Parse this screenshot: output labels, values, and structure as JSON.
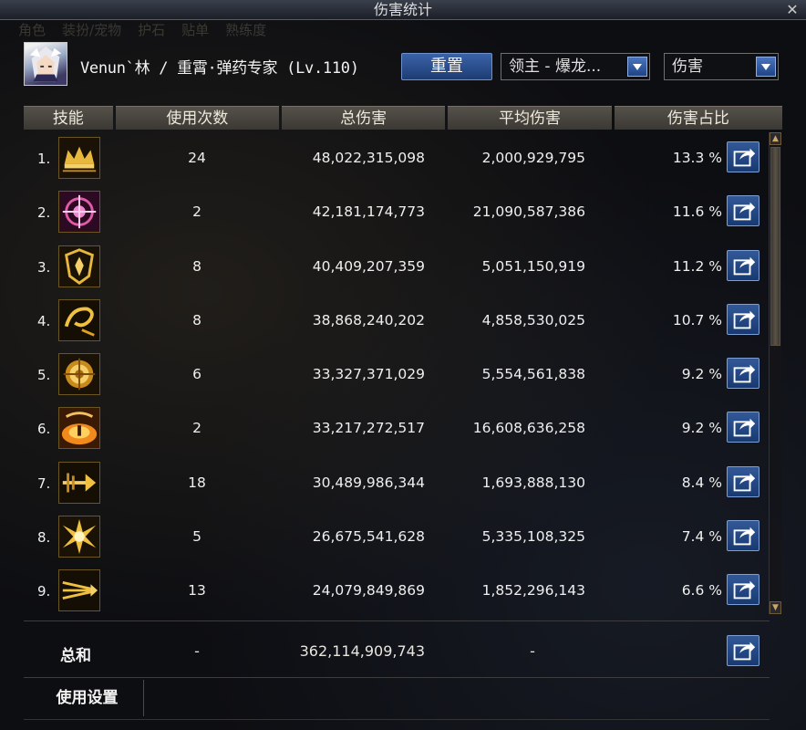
{
  "window": {
    "title": "伤害统计",
    "close_label": "✕"
  },
  "background_tabs": [
    "角色",
    "装扮/宠物",
    "护石",
    "贴单",
    "熟练度"
  ],
  "character": {
    "name_line": "Venun`林 / 重霄·弹药专家 (Lv.110)"
  },
  "controls": {
    "reset_label": "重置",
    "target_select": {
      "value": "领主 - 爆龙..."
    },
    "metric_select": {
      "value": "伤害"
    }
  },
  "table": {
    "headers": {
      "skill": "技能",
      "count": "使用次数",
      "total": "总伤害",
      "avg": "平均伤害",
      "share": "伤害占比"
    },
    "rows": [
      {
        "num": "1.",
        "icon": "golden-crown-skill-icon",
        "count": "24",
        "total": "48,022,315,098",
        "avg": "2,000,929,795",
        "share": "13.3 %"
      },
      {
        "num": "2.",
        "icon": "pink-crosshair-skill-icon",
        "count": "2",
        "total": "42,181,174,773",
        "avg": "21,090,587,386",
        "share": "11.6 %"
      },
      {
        "num": "3.",
        "icon": "golden-shield-skill-icon",
        "count": "8",
        "total": "40,409,207,359",
        "avg": "5,051,150,919",
        "share": "11.2 %"
      },
      {
        "num": "4.",
        "icon": "golden-swirl-skill-icon",
        "count": "8",
        "total": "38,868,240,202",
        "avg": "4,858,530,025",
        "share": "10.7 %"
      },
      {
        "num": "5.",
        "icon": "golden-target-skill-icon",
        "count": "6",
        "total": "33,327,371,029",
        "avg": "5,554,561,838",
        "share": "9.2 %"
      },
      {
        "num": "6.",
        "icon": "orange-blast-skill-icon",
        "count": "2",
        "total": "33,217,272,517",
        "avg": "16,608,636,258",
        "share": "9.2 %"
      },
      {
        "num": "7.",
        "icon": "golden-arrow-skill-icon",
        "count": "18",
        "total": "30,489,986,344",
        "avg": "1,693,888,130",
        "share": "8.4 %"
      },
      {
        "num": "8.",
        "icon": "golden-burst-skill-icon",
        "count": "5",
        "total": "26,675,541,628",
        "avg": "5,335,108,325",
        "share": "7.4 %"
      },
      {
        "num": "9.",
        "icon": "golden-spikes-skill-icon",
        "count": "13",
        "total": "24,079,849,869",
        "avg": "1,852,296,143",
        "share": "6.6 %"
      }
    ]
  },
  "total": {
    "label": "总和",
    "count": "-",
    "total": "362,114,909,743",
    "avg": "-"
  },
  "footer": {
    "settings_tab": "使用设置"
  },
  "colors": {
    "accent_blue": "#2a4f8f",
    "header_bg": "#4a4640",
    "panel_bg": "#0d0e12",
    "icon_gold": "#e0b43a"
  }
}
